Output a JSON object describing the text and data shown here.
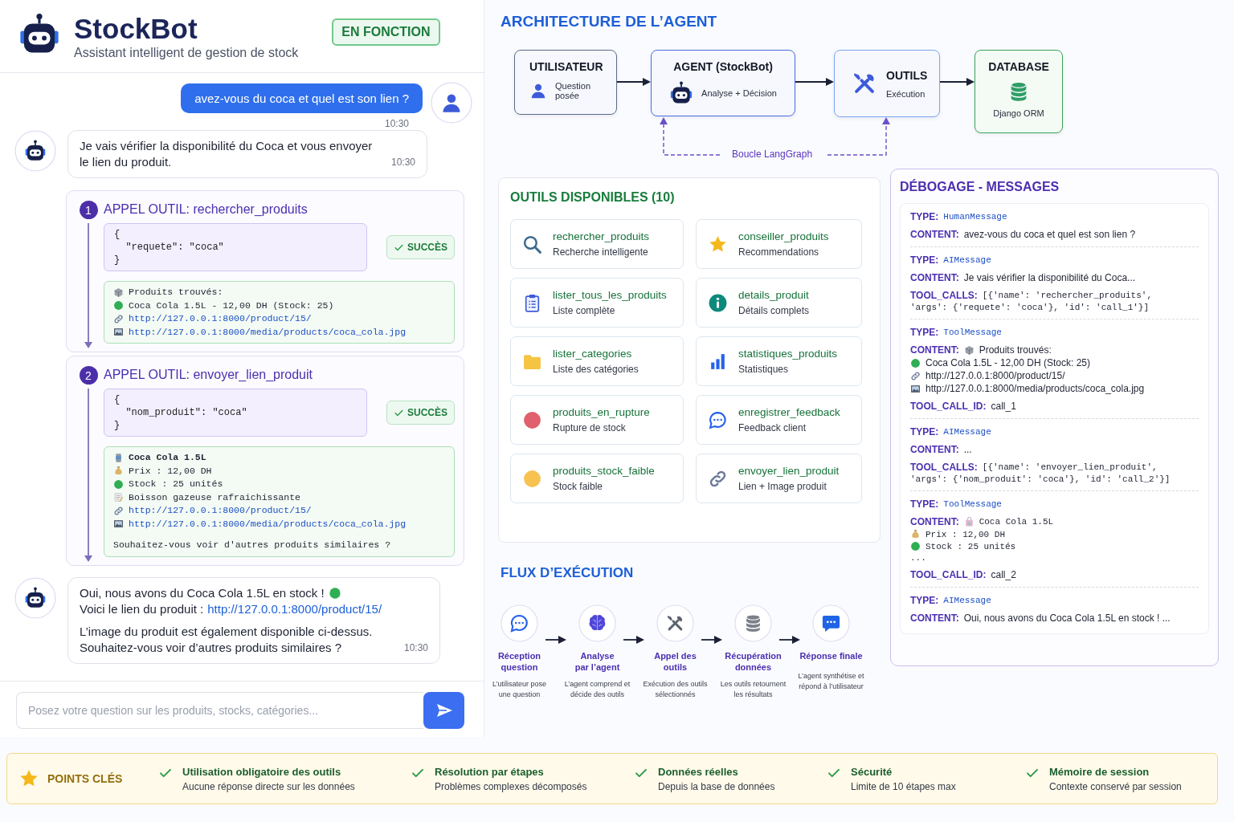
{
  "chat": {
    "header": {
      "title": "StockBot",
      "subtitle": "Assistant intelligent de gestion de stock",
      "status": "EN FONCTION"
    },
    "messages": [
      {
        "kind": "user",
        "text": "avez-vous du coca et quel est son lien ?",
        "time": "10:30"
      },
      {
        "kind": "bot",
        "paragraphs": [
          [
            {
              "text": "Je vais vérifier la disponibilité du Coca et vous envoyer le lien du produit."
            }
          ]
        ],
        "time": "10:30"
      },
      {
        "kind": "tool_call",
        "number": "1",
        "title": "APPEL OUTIL: rechercher_produits",
        "args": [
          "{",
          "  \"requete\": \"coca\"",
          "}"
        ],
        "status": "SUCCÈS",
        "result": [
          {
            "kind": "box",
            "text": "Produits trouvés:",
            "bold": false
          },
          {
            "kind": "dot",
            "text": "Coca Cola 1.5L - 12,00 DH (Stock: 25)",
            "bold": false
          },
          {
            "kind": "link",
            "text": "http://127.0.0.1:8000/product/15/",
            "bold": false
          },
          {
            "kind": "image",
            "text": "http://127.0.0.1:8000/media/products/coca_cola.jpg",
            "bold": false
          }
        ]
      },
      {
        "kind": "tool_call",
        "number": "2",
        "title": "APPEL OUTIL: envoyer_lien_produit",
        "args": [
          "{",
          "  \"nom_produit\": \"coca\"",
          "}"
        ],
        "status": "SUCCÈS",
        "result": [
          {
            "kind": "can",
            "text": "Coca Cola 1.5L",
            "bold": true
          },
          {
            "kind": "money",
            "text": "Prix : 12,00 DH",
            "bold": false
          },
          {
            "kind": "dot",
            "text": "Stock : 25 unités",
            "bold": false
          },
          {
            "kind": "note",
            "text": "Boisson gazeuse rafraichissante",
            "bold": false
          },
          {
            "kind": "link",
            "text": "http://127.0.0.1:8000/product/15/",
            "bold": false
          },
          {
            "kind": "image",
            "text": "http://127.0.0.1:8000/media/products/coca_cola.jpg",
            "bold": false
          }
        ],
        "footer": "Souhaitez-vous voir d'autres produits similaires ?"
      },
      {
        "kind": "bot",
        "paragraphs": [
          [
            {
              "text": "Oui, nous avons du Coca Cola 1.5L en stock !",
              "kind": "dot"
            },
            {
              "text": "Voici le lien du produit :",
              "link": "http://127.0.0.1:8000/product/15/"
            }
          ],
          [
            {
              "text": "L’image du produit est également disponible ci-dessus."
            },
            {
              "text": "Souhaitez-vous voir d’autres produits similaires ?"
            }
          ]
        ],
        "time": "10:30"
      }
    ],
    "input": {
      "placeholder": "Posez votre question sur les produits, stocks, catégories..."
    }
  },
  "architecture": {
    "title": "ARCHITECTURE DE L’AGENT",
    "nodes": [
      {
        "kind": "user",
        "title": "UTILISATEUR",
        "subtitle": "Question posée"
      },
      {
        "kind": "agent",
        "title": "AGENT (StockBot)",
        "subtitle": "Analyse + Décision"
      },
      {
        "kind": "tools",
        "title": "OUTILS",
        "subtitle": "Exécution"
      },
      {
        "kind": "database",
        "title": "DATABASE",
        "subtitle": "Django ORM"
      }
    ],
    "loop_label": "Boucle LangGraph"
  },
  "tools": {
    "title": "OUTILS DISPONIBLES (10)",
    "items": [
      {
        "kind": "search",
        "name": "rechercher_produits",
        "description": "Recherche intelligente"
      },
      {
        "kind": "star",
        "name": "conseiller_produits",
        "description": "Recommendations"
      },
      {
        "kind": "clipboard",
        "name": "lister_tous_les_produits",
        "description": "Liste complète"
      },
      {
        "kind": "info",
        "name": "details_produit",
        "description": "Détails complets"
      },
      {
        "kind": "folder",
        "name": "lister_categories",
        "description": "Liste des catégories"
      },
      {
        "kind": "chart",
        "name": "statistiques_produits",
        "description": "Statistiques"
      },
      {
        "kind": "danger",
        "name": "produits_en_rupture",
        "description": "Rupture de stock"
      },
      {
        "kind": "chat",
        "name": "enregistrer_feedback",
        "description": "Feedback client"
      },
      {
        "kind": "warning",
        "name": "produits_stock_faible",
        "description": "Stock faible"
      },
      {
        "kind": "link",
        "name": "envoyer_lien_produit",
        "description": "Lien + Image produit"
      }
    ]
  },
  "flow": {
    "title": "FLUX D’EXÉCUTION",
    "steps": [
      {
        "kind": "chat",
        "title": "Réception\nquestion",
        "description": "L’utilisateur pose\nune question"
      },
      {
        "kind": "brain",
        "title": "Analyse\npar l’agent",
        "description": "L’agent comprend et\ndécide des outils"
      },
      {
        "kind": "tools",
        "title": "Appel des\noutils",
        "description": "Exécution des outils\nsélectionnés"
      },
      {
        "kind": "database",
        "title": "Récupération\ndonnées",
        "description": "Les outils retournent\nles résultats"
      },
      {
        "kind": "message",
        "title": "Réponse finale",
        "description": "L’agent synthétise et\nrépond à l’utilisateur"
      }
    ]
  },
  "debug": {
    "title": "DÉBOGAGE - MESSAGES",
    "messages": [
      {
        "type_label": "TYPE:",
        "type": "HumanMessage",
        "fields": [
          {
            "label": "CONTENT:",
            "kind": "text",
            "lines": [
              {
                "text": "avez-vous du coca et quel est son lien ?"
              }
            ]
          }
        ]
      },
      {
        "type_label": "TYPE:",
        "type": "AIMessage",
        "fields": [
          {
            "label": "CONTENT:",
            "kind": "text",
            "lines": [
              {
                "text": "Je vais vérifier la disponibilité du Coca..."
              }
            ]
          },
          {
            "label": "TOOL_CALLS:",
            "kind": "code",
            "lines": [
              {
                "text": "[{'name': 'rechercher_produits',"
              },
              {
                "text": "'args': {'requete': 'coca'}, 'id': 'call_1'}]"
              }
            ]
          }
        ]
      },
      {
        "type_label": "TYPE:",
        "type": "ToolMessage",
        "fields": [
          {
            "label": "CONTENT:",
            "kind": "text",
            "lines": [
              {
                "kind": "box",
                "text": "Produits trouvés:"
              },
              {
                "kind": "dot",
                "text": "Coca Cola 1.5L - 12,00 DH (Stock: 25)"
              },
              {
                "kind": "link",
                "text": "http://127.0.0.1:8000/product/15/"
              },
              {
                "kind": "image",
                "text": "http://127.0.0.1:8000/media/products/coca_cola.jpg"
              }
            ]
          },
          {
            "label": "TOOL_CALL_ID:",
            "kind": "text",
            "lines": [
              {
                "text": "call_1"
              }
            ]
          }
        ]
      },
      {
        "type_label": "TYPE:",
        "type": "AIMessage",
        "fields": [
          {
            "label": "CONTENT:",
            "kind": "text",
            "lines": [
              {
                "text": "..."
              }
            ]
          },
          {
            "label": "TOOL_CALLS:",
            "kind": "code",
            "lines": [
              {
                "text": "[{'name': 'envoyer_lien_produit',"
              },
              {
                "text": "'args': {'nom_produit': 'coca'}, 'id': 'call_2'}]"
              }
            ]
          }
        ]
      },
      {
        "type_label": "TYPE:",
        "type": "ToolMessage",
        "fields": [
          {
            "label": "CONTENT:",
            "kind": "code",
            "lines": [
              {
                "kind": "bag",
                "text": "Coca Cola 1.5L"
              },
              {
                "kind": "money",
                "text": "Prix : 12,00 DH"
              },
              {
                "kind": "dot",
                "text": "Stock : 25 unités"
              },
              {
                "text": "..."
              }
            ]
          },
          {
            "label": "TOOL_CALL_ID:",
            "kind": "text",
            "lines": [
              {
                "text": "call_2"
              }
            ]
          }
        ]
      },
      {
        "type_label": "TYPE:",
        "type": "AIMessage",
        "fields": [
          {
            "label": "CONTENT:",
            "kind": "text",
            "lines": [
              {
                "text": "Oui, nous avons du Coca Cola 1.5L en stock ! ..."
              }
            ]
          }
        ]
      }
    ]
  },
  "key_points": {
    "title": "POINTS CLÉS",
    "items": [
      {
        "title": "Utilisation obligatoire des outils",
        "description": "Aucune réponse directe sur les données"
      },
      {
        "title": "Résolution par étapes",
        "description": "Problèmes complexes décomposés"
      },
      {
        "title": "Données réelles",
        "description": "Depuis la base de données"
      },
      {
        "title": "Sécurité",
        "description": "Limite de 10 étapes max"
      },
      {
        "title": "Mémoire de session",
        "description": "Contexte conservé par session"
      }
    ]
  }
}
